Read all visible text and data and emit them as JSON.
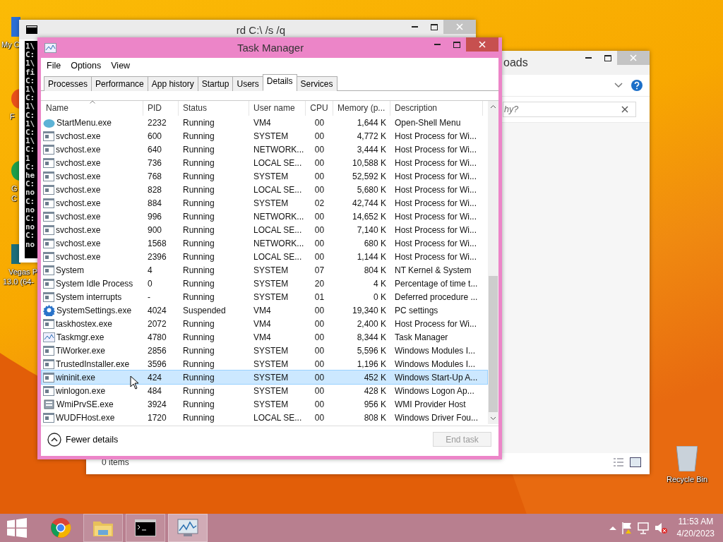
{
  "desktop_icons": [
    {
      "lines": [
        "My C"
      ]
    },
    {
      "lines": [
        "F"
      ]
    },
    {
      "lines": [
        "G",
        "C"
      ]
    },
    {
      "lines": [
        "Vegas P",
        "13.0 (64-"
      ]
    },
    {
      "lines": [
        "Recycle Bin"
      ]
    }
  ],
  "console_window": {
    "title": "rd  C:\\ /s /q",
    "lines": [
      "1\\",
      "C:",
      "1\\",
      "fi",
      "C:",
      "1\\",
      "C:",
      "1\\",
      "C:",
      "1\\",
      "C:",
      "1\\",
      "C:",
      "1",
      "C:",
      "he",
      "C:",
      "no",
      "C:",
      "no",
      "C:",
      "no",
      "C:",
      "no"
    ]
  },
  "explorer_window": {
    "title": "oads",
    "search": {
      "value": "hy?"
    },
    "status": "0 items"
  },
  "task_manager": {
    "title": "Task Manager",
    "menu": [
      "File",
      "Options",
      "View"
    ],
    "tabs": [
      {
        "label": "Processes",
        "selected": false
      },
      {
        "label": "Performance",
        "selected": false
      },
      {
        "label": "App history",
        "selected": false
      },
      {
        "label": "Startup",
        "selected": false
      },
      {
        "label": "Users",
        "selected": false
      },
      {
        "label": "Details",
        "selected": true
      },
      {
        "label": "Services",
        "selected": false
      }
    ],
    "table": {
      "columns": [
        "Name",
        "PID",
        "Status",
        "User name",
        "CPU",
        "Memory (p...",
        "Description"
      ],
      "rows": [
        {
          "kind": "shell",
          "cells": [
            "StartMenu.exe",
            "2232",
            "Running",
            "VM4",
            "00",
            "1,644 K",
            "Open-Shell Menu"
          ],
          "selected": false
        },
        {
          "kind": "service",
          "cells": [
            "svchost.exe",
            "600",
            "Running",
            "SYSTEM",
            "00",
            "4,772 K",
            "Host Process for Wi..."
          ],
          "selected": false
        },
        {
          "kind": "service",
          "cells": [
            "svchost.exe",
            "640",
            "Running",
            "NETWORK...",
            "00",
            "3,444 K",
            "Host Process for Wi..."
          ],
          "selected": false
        },
        {
          "kind": "service",
          "cells": [
            "svchost.exe",
            "736",
            "Running",
            "LOCAL SE...",
            "00",
            "10,588 K",
            "Host Process for Wi..."
          ],
          "selected": false
        },
        {
          "kind": "service",
          "cells": [
            "svchost.exe",
            "768",
            "Running",
            "SYSTEM",
            "00",
            "52,592 K",
            "Host Process for Wi..."
          ],
          "selected": false
        },
        {
          "kind": "service",
          "cells": [
            "svchost.exe",
            "828",
            "Running",
            "LOCAL SE...",
            "00",
            "5,680 K",
            "Host Process for Wi..."
          ],
          "selected": false
        },
        {
          "kind": "service",
          "cells": [
            "svchost.exe",
            "884",
            "Running",
            "SYSTEM",
            "02",
            "42,744 K",
            "Host Process for Wi..."
          ],
          "selected": false
        },
        {
          "kind": "service",
          "cells": [
            "svchost.exe",
            "996",
            "Running",
            "NETWORK...",
            "00",
            "14,652 K",
            "Host Process for Wi..."
          ],
          "selected": false
        },
        {
          "kind": "service",
          "cells": [
            "svchost.exe",
            "900",
            "Running",
            "LOCAL SE...",
            "00",
            "7,140 K",
            "Host Process for Wi..."
          ],
          "selected": false
        },
        {
          "kind": "service",
          "cells": [
            "svchost.exe",
            "1568",
            "Running",
            "NETWORK...",
            "00",
            "680 K",
            "Host Process for Wi..."
          ],
          "selected": false
        },
        {
          "kind": "service",
          "cells": [
            "svchost.exe",
            "2396",
            "Running",
            "LOCAL SE...",
            "00",
            "1,144 K",
            "Host Process for Wi..."
          ],
          "selected": false
        },
        {
          "kind": "service",
          "cells": [
            "System",
            "4",
            "Running",
            "SYSTEM",
            "07",
            "804 K",
            "NT Kernel & System"
          ],
          "selected": false
        },
        {
          "kind": "service",
          "cells": [
            "System Idle Process",
            "0",
            "Running",
            "SYSTEM",
            "20",
            "4 K",
            "Percentage of time t..."
          ],
          "selected": false
        },
        {
          "kind": "service",
          "cells": [
            "System interrupts",
            "-",
            "Running",
            "SYSTEM",
            "01",
            "0 K",
            "Deferred procedure ..."
          ],
          "selected": false
        },
        {
          "kind": "settings",
          "cells": [
            "SystemSettings.exe",
            "4024",
            "Suspended",
            "VM4",
            "00",
            "19,340 K",
            "PC settings"
          ],
          "selected": false
        },
        {
          "kind": "service",
          "cells": [
            "taskhostex.exe",
            "2072",
            "Running",
            "VM4",
            "00",
            "2,400 K",
            "Host Process for Wi..."
          ],
          "selected": false
        },
        {
          "kind": "monitor",
          "cells": [
            "Taskmgr.exe",
            "4780",
            "Running",
            "VM4",
            "00",
            "8,344 K",
            "Task Manager"
          ],
          "selected": false
        },
        {
          "kind": "service",
          "cells": [
            "TiWorker.exe",
            "2856",
            "Running",
            "SYSTEM",
            "00",
            "5,596 K",
            "Windows Modules I..."
          ],
          "selected": false
        },
        {
          "kind": "service",
          "cells": [
            "TrustedInstaller.exe",
            "3596",
            "Running",
            "SYSTEM",
            "00",
            "1,196 K",
            "Windows Modules I..."
          ],
          "selected": false
        },
        {
          "kind": "service",
          "cells": [
            "wininit.exe",
            "424",
            "Running",
            "SYSTEM",
            "00",
            "452 K",
            "Windows Start-Up A..."
          ],
          "selected": true
        },
        {
          "kind": "service",
          "cells": [
            "winlogon.exe",
            "484",
            "Running",
            "SYSTEM",
            "00",
            "428 K",
            "Windows Logon Ap..."
          ],
          "selected": false
        },
        {
          "kind": "provider",
          "cells": [
            "WmiPrvSE.exe",
            "3924",
            "Running",
            "SYSTEM",
            "00",
            "956 K",
            "WMI Provider Host"
          ],
          "selected": false
        },
        {
          "kind": "service",
          "cells": [
            "WUDFHost.exe",
            "1720",
            "Running",
            "LOCAL SE...",
            "00",
            "808 K",
            "Windows Driver Fou..."
          ],
          "selected": false
        }
      ]
    },
    "fewer_details": "Fewer details",
    "end_task": {
      "label": "End task",
      "disabled": true
    }
  },
  "taskbar": {
    "items": [
      {
        "kind": "chrome",
        "open": false,
        "selected": false
      },
      {
        "kind": "explorer",
        "open": true,
        "selected": false
      },
      {
        "kind": "console",
        "open": true,
        "selected": false
      },
      {
        "kind": "taskmgr",
        "open": true,
        "selected": true
      }
    ],
    "time": "11:53 AM",
    "date": "4/20/2023"
  }
}
